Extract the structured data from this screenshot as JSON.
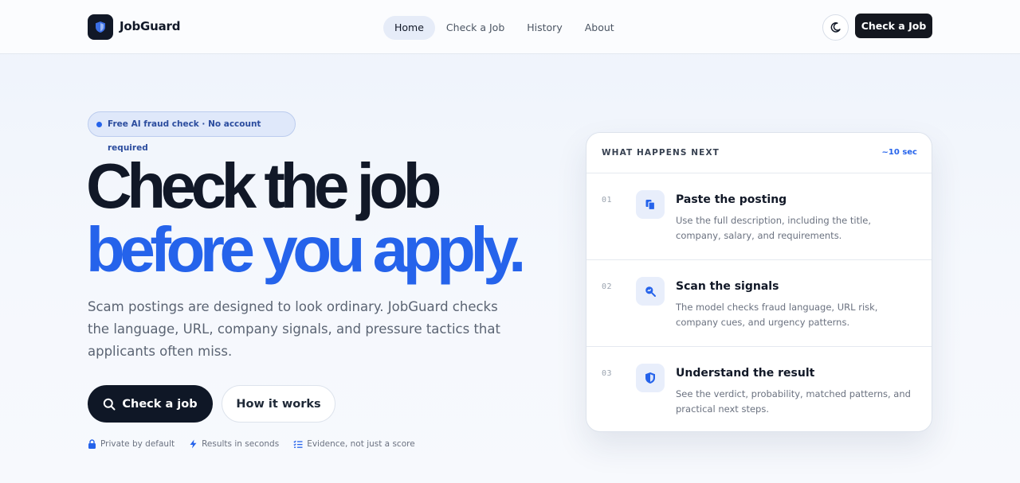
{
  "header": {
    "brand": "JobGuard",
    "nav": [
      "Home",
      "Check a Job",
      "History",
      "About"
    ],
    "active_nav": "Home",
    "cta_label": "Check a Job",
    "theme_icon": "moon-icon"
  },
  "hero": {
    "pill": "Free AI fraud check · No account required",
    "headline_line1": "Check the job",
    "headline_line2": "before you apply.",
    "subtitle": "Scam postings are designed to look ordinary. JobGuard checks the language, URL, company signals, and pressure tactics that applicants often miss.",
    "primary_button": "Check a job",
    "secondary_button": "How it works",
    "trust": [
      {
        "icon": "lock-icon",
        "label": "Private by default"
      },
      {
        "icon": "bolt-icon",
        "label": "Results in seconds"
      },
      {
        "icon": "checklist-icon",
        "label": "Evidence, not just a score"
      }
    ]
  },
  "card": {
    "title": "WHAT HAPPENS NEXT",
    "eta": "~10 sec",
    "steps": [
      {
        "num": "01",
        "icon": "clipboard-icon",
        "title": "Paste the posting",
        "desc": "Use the full description, including the title, company, salary, and requirements."
      },
      {
        "num": "02",
        "icon": "magnifier-icon",
        "title": "Scan the signals",
        "desc": "The model checks fraud language, URL risk, company cues, and urgency patterns."
      },
      {
        "num": "03",
        "icon": "shield-icon",
        "title": "Understand the result",
        "desc": "See the verdict, probability, matched patterns, and practical next steps."
      }
    ]
  },
  "colors": {
    "accent": "#2563eb",
    "dark": "#111827",
    "muted": "#6b7280"
  }
}
